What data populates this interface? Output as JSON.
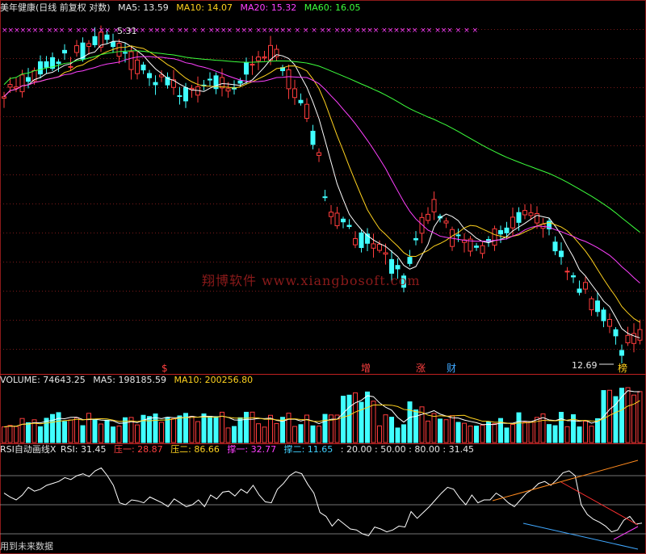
{
  "header": {
    "title": "美年健康(日线 前复权 对数)",
    "ma5": "MA5: 13.59",
    "ma10": "MA10: 14.07",
    "ma20": "MA20: 15.32",
    "ma60": "MA60: 16.05"
  },
  "volume_header": {
    "label": "VOLUME: 74643.25",
    "ma5": "MA5: 198185.59",
    "ma10": "MA10: 200256.80"
  },
  "rsi_header": {
    "label": "RSI自动画线X",
    "rsi": "RSI: 31.45",
    "ya1": "压一: 28.87",
    "ya2": "压二: 86.66",
    "cheng1": "撑一: 32.77",
    "cheng2": "撑二: 11.65",
    "levels": ": 20.00 : 50.00 : 80.00 : 31.45"
  },
  "footer_text": "用到未来数据",
  "watermark": "翔博软件 www.xiangbosoft.com",
  "colors": {
    "up": "#ff3c3c",
    "down": "#40ffff",
    "ma5": "#ffffff",
    "ma10": "#ffd21e",
    "ma20": "#ff40ff",
    "ma60": "#3cff3c",
    "grid": "#7a1a1a",
    "resistance": "#ff8a1e",
    "support": "#40a8ff"
  },
  "chart_data": [
    {
      "type": "candlestick",
      "title": "美年健康(日线 前复权 对数)",
      "low_marker": "12.69",
      "high_marker": "5.31",
      "marker_labels": [
        "$",
        "增",
        "涨",
        "财",
        "榜"
      ],
      "series": [
        {
          "name": "MA5",
          "last": 13.59
        },
        {
          "name": "MA10",
          "last": 14.07
        },
        {
          "name": "MA20",
          "last": 15.32
        },
        {
          "name": "MA60",
          "last": 16.05
        }
      ]
    },
    {
      "type": "bar",
      "title": "VOLUME",
      "series": [
        {
          "name": "VOLUME",
          "last": 74643.25
        },
        {
          "name": "MA5",
          "last": 198185.59
        },
        {
          "name": "MA10",
          "last": 200256.8
        }
      ]
    },
    {
      "type": "line",
      "title": "RSI自动画线X",
      "reference_levels": [
        20,
        50,
        80
      ],
      "ylim": [
        0,
        100
      ],
      "values": [
        62,
        58,
        55,
        60,
        68,
        64,
        66,
        70,
        72,
        74,
        78,
        76,
        80,
        82,
        79,
        85,
        88,
        80,
        70,
        52,
        50,
        55,
        54,
        52,
        58,
        55,
        52,
        48,
        56,
        52,
        48,
        50,
        55,
        48,
        60,
        56,
        63,
        64,
        59,
        66,
        62,
        70,
        60,
        53,
        52,
        66,
        72,
        80,
        84,
        82,
        71,
        62,
        42,
        38,
        28,
        35,
        30,
        25,
        24,
        20,
        18,
        27,
        25,
        22,
        24,
        28,
        27,
        43,
        36,
        42,
        48,
        55,
        62,
        68,
        66,
        57,
        50,
        60,
        52,
        55,
        55,
        62,
        58,
        52,
        48,
        55,
        62,
        66,
        72,
        74,
        70,
        76,
        83,
        85,
        80,
        50,
        40,
        35,
        32,
        28,
        22,
        24,
        34,
        38,
        30,
        31
      ],
      "series": [
        {
          "name": "RSI",
          "last": 31.45
        },
        {
          "name": "压一",
          "last": 28.87
        },
        {
          "name": "压二",
          "last": 86.66
        },
        {
          "name": "撑一",
          "last": 32.77
        },
        {
          "name": "撑二",
          "last": 11.65
        }
      ]
    }
  ]
}
